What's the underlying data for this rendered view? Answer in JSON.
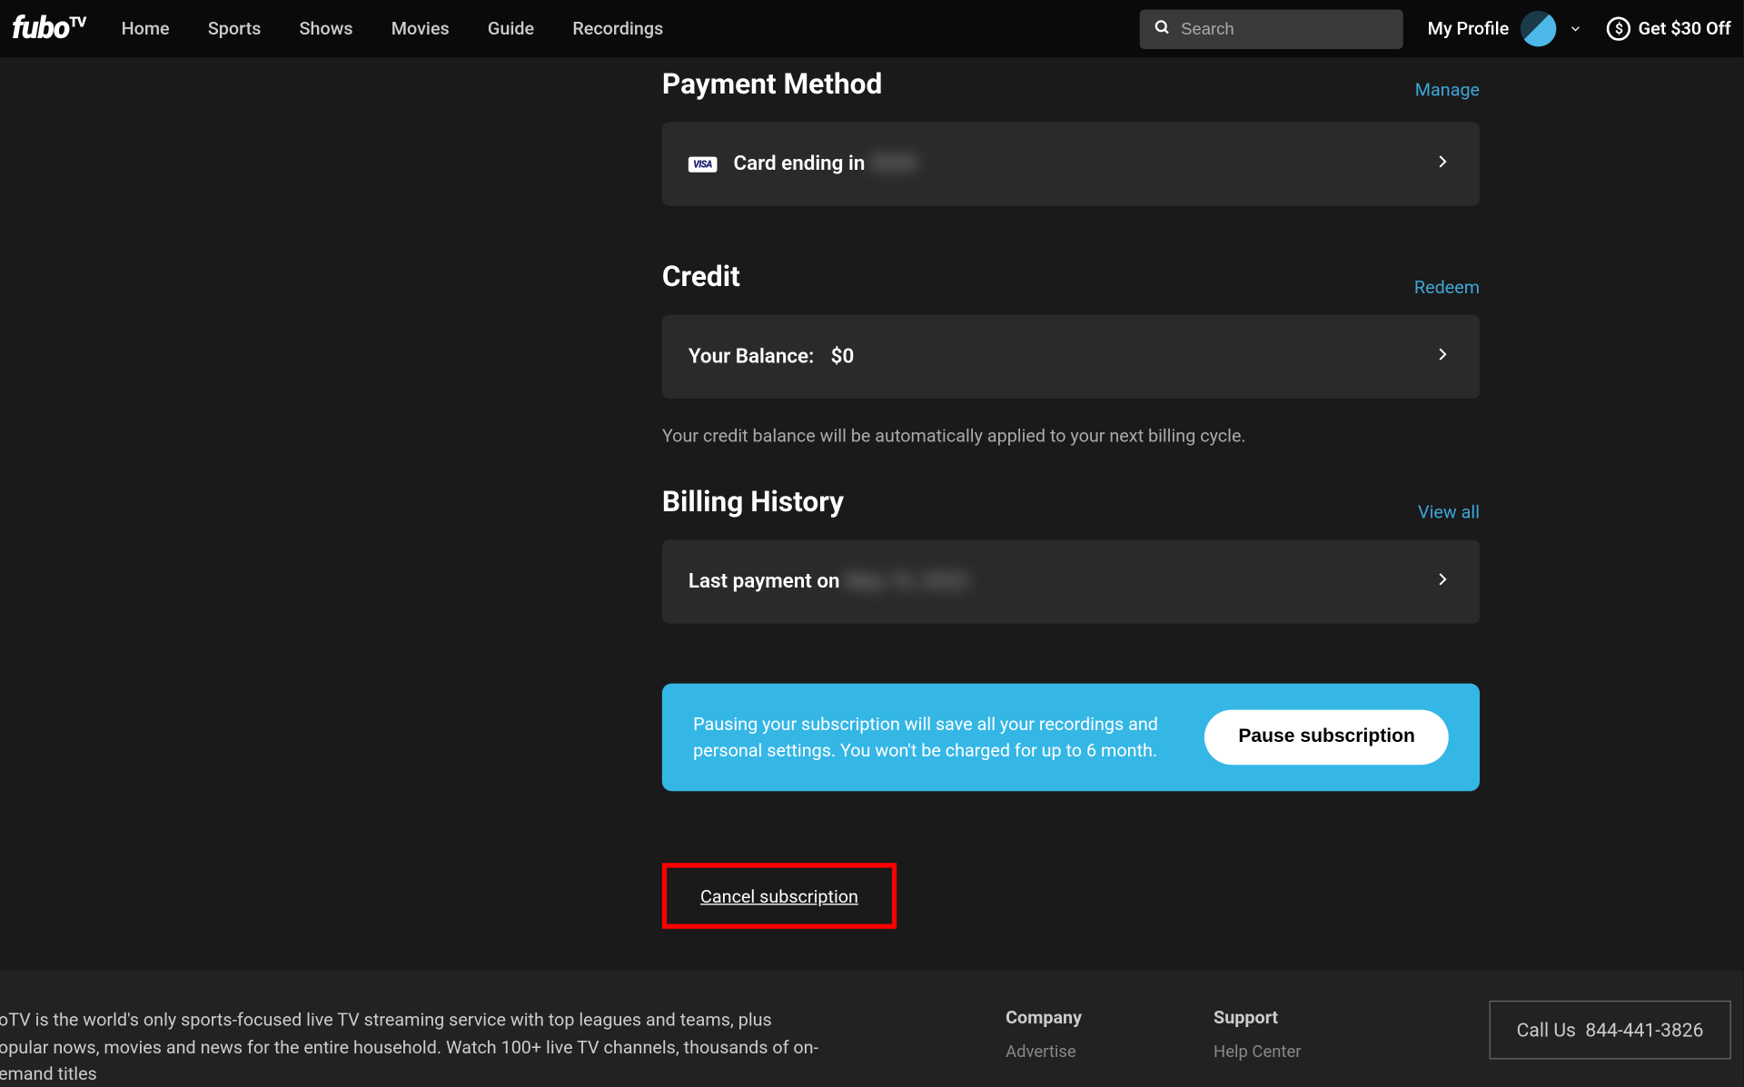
{
  "header": {
    "logo": "fubo",
    "logo_suffix": "TV",
    "nav": [
      "Home",
      "Sports",
      "Shows",
      "Movies",
      "Guide",
      "Recordings"
    ],
    "search_placeholder": "Search",
    "my_profile": "My Profile",
    "get_off": "Get $30 Off"
  },
  "payment_method": {
    "title": "Payment Method",
    "manage": "Manage",
    "card_label": "Card ending in",
    "card_last": "0000",
    "visa": "VISA"
  },
  "credit": {
    "title": "Credit",
    "redeem": "Redeem",
    "balance_label": "Your Balance:",
    "balance_value": "$0",
    "note": "Your credit balance will be automatically applied to your next billing cycle."
  },
  "billing_history": {
    "title": "Billing History",
    "view_all": "View all",
    "last_payment_label": "Last payment on",
    "last_payment_date": "May 10, 2022"
  },
  "pause": {
    "text": "Pausing your subscription will save all your recordings and personal settings. You won't be charged for up to 6 month.",
    "button": "Pause subscription"
  },
  "cancel": "Cancel subscription",
  "footer": {
    "about": "boTV is the world's only sports-focused live TV streaming service with top leagues and teams, plus popular nows, movies and news for the entire household. Watch 100+ live TV channels, thousands of on-demand titles",
    "company": {
      "title": "Company",
      "links": [
        "Advertise"
      ]
    },
    "support": {
      "title": "Support",
      "links": [
        "Help Center"
      ]
    },
    "call_us_label": "Call Us",
    "call_us_number": "844-441-3826"
  }
}
